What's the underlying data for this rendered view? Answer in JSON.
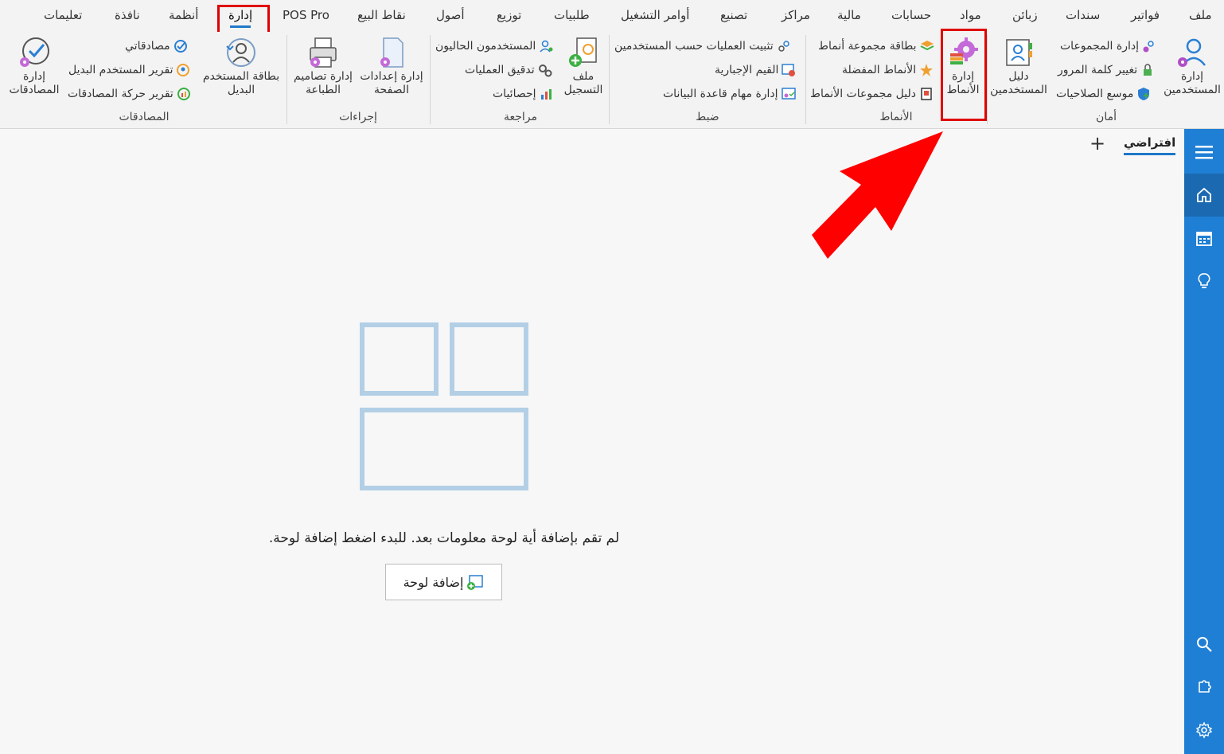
{
  "menu": {
    "items": [
      "ملف",
      "فواتير",
      "سندات",
      "زبائن",
      "مواد",
      "حسابات",
      "مالية",
      "مراكز",
      "تصنيع",
      "أوامر التشغيل",
      "طلبيات",
      "توزيع",
      "أصول",
      "نقاط البيع",
      "POS Pro",
      "إدارة",
      "أنظمة",
      "نافذة",
      "تعليمات"
    ],
    "active": "إدارة"
  },
  "ribbon": {
    "groups": {
      "security": "أمان",
      "patterns": "الأنماط",
      "control": "ضبط",
      "review": "مراجعة",
      "procedures": "إجراءات",
      "approvals": "المصادقات"
    },
    "security": {
      "manage_users": "إدارة المستخدمين",
      "manage_groups": "إدارة المجموعات",
      "change_password": "تغيير كلمة المرور",
      "permissions_extender": "موسع الصلاحيات",
      "users_guide": "دليل المستخدمين"
    },
    "patterns": {
      "manage_patterns": "إدارة الأنماط",
      "pattern_group_card": "بطاقة مجموعة أنماط",
      "favorite_patterns": "الأنماط المفضلة",
      "pattern_groups_guide": "دليل مجموعات الأنماط"
    },
    "control": {
      "fix_ops_by_users": "تثبيت العمليات حسب المستخدمين",
      "mandatory_values": "القيم الإجبارية",
      "db_tasks": "إدارة مهام قاعدة البيانات"
    },
    "review": {
      "log_file": "ملف التسجيل",
      "current_users": "المستخدمون الحاليون",
      "ops_audit": "تدقيق العمليات",
      "statistics": "إحصائيات"
    },
    "procedures": {
      "page_settings": "إدارة إعدادات الصفحة",
      "print_designs": "إدارة تصاميم الطباعة"
    },
    "approvals": {
      "alt_user_card": "بطاقة المستخدم البديل",
      "my_approvals": "مصادقاتي",
      "alt_user_report": "تقرير المستخدم البديل",
      "approvals_movement_report": "تقرير حركة المصادقات",
      "manage_approvals": "إدارة المصادقات"
    }
  },
  "tabs": {
    "default_label": "افتراضي",
    "add_symbol": "+"
  },
  "empty_state": {
    "message": "لم تقم بإضافة أية لوحة معلومات بعد. للبدء اضغط إضافة لوحة.",
    "add_button": "إضافة لوحة"
  },
  "sidebar": {
    "icons": [
      "menu-icon",
      "home-icon",
      "calendar-icon",
      "lightbulb-icon",
      "search-icon",
      "puzzle-icon",
      "settings-icon"
    ]
  },
  "colors": {
    "accent": "#1f7fd4",
    "highlight": "#e00000"
  }
}
